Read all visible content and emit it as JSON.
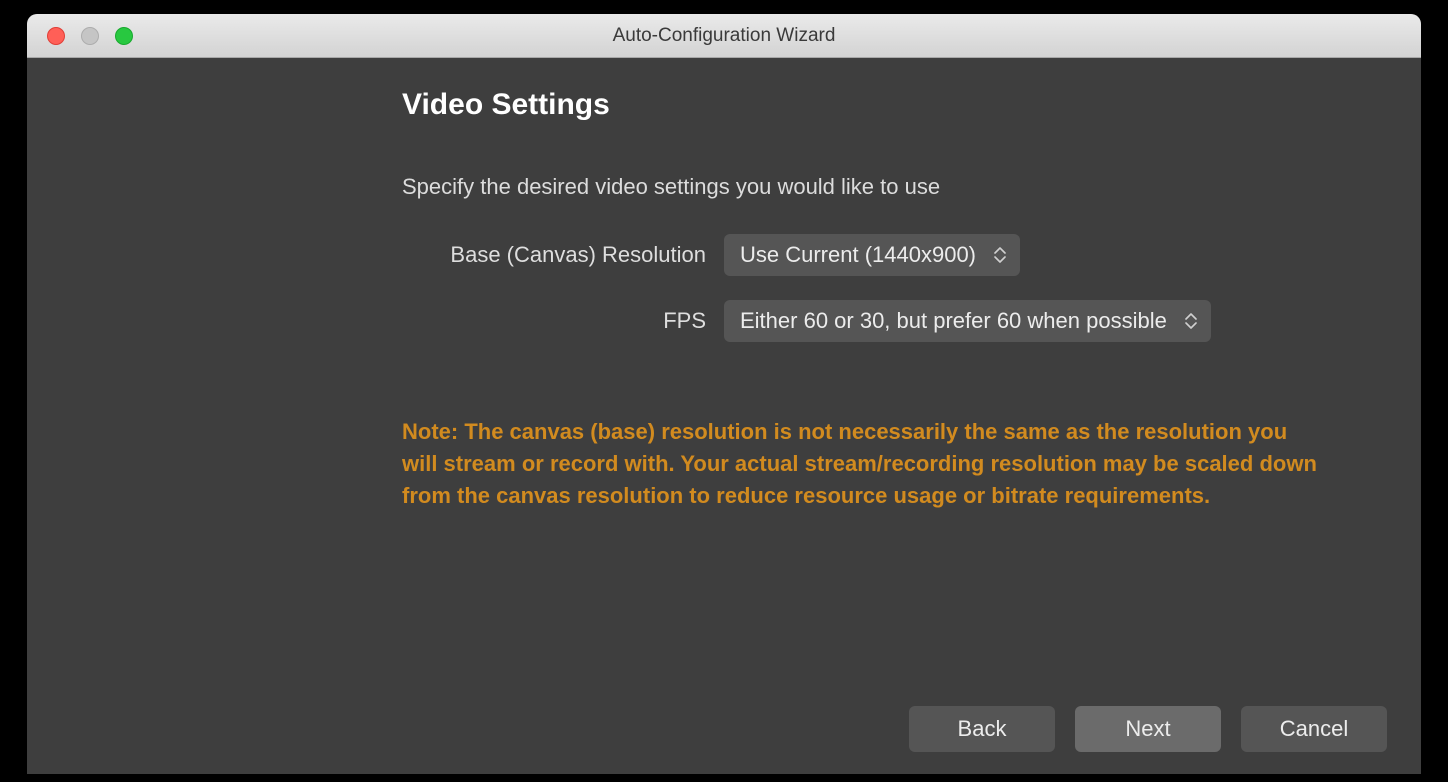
{
  "window": {
    "title": "Auto-Configuration Wizard"
  },
  "page": {
    "title": "Video Settings",
    "subtitle": "Specify the desired video settings you would like to use"
  },
  "fields": {
    "resolution": {
      "label": "Base (Canvas) Resolution",
      "value": "Use Current (1440x900)"
    },
    "fps": {
      "label": "FPS",
      "value": "Either 60 or 30, but prefer 60 when possible"
    }
  },
  "note": "Note: The canvas (base) resolution is not necessarily the same as the resolution you will stream or record with. Your actual stream/recording resolution may be scaled down from the canvas resolution to reduce resource usage or bitrate requirements.",
  "buttons": {
    "back": "Back",
    "next": "Next",
    "cancel": "Cancel"
  }
}
